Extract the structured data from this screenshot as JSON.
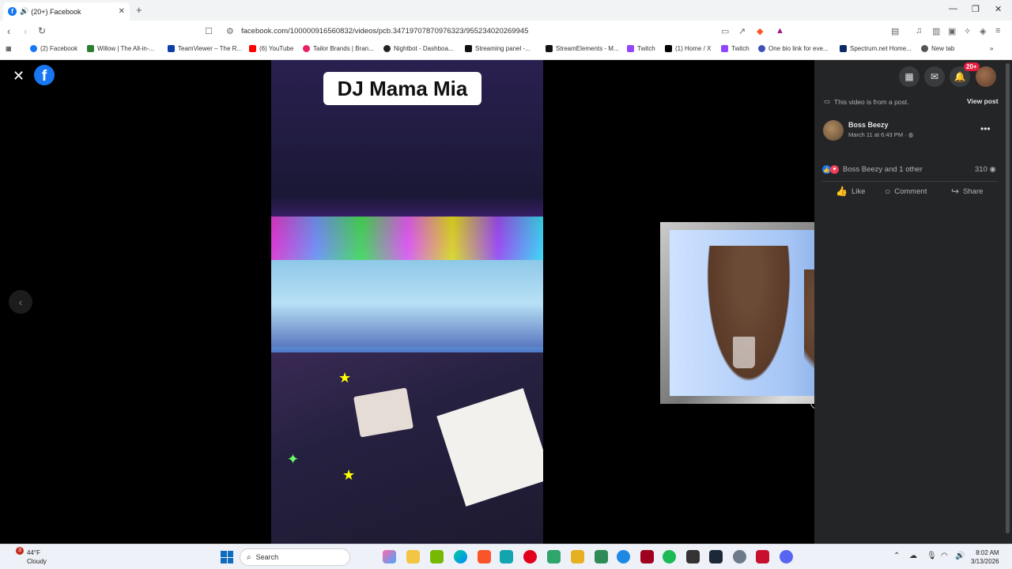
{
  "browser": {
    "tab_title": "(20+) Facebook",
    "new_tab_symbol": "+",
    "url": "facebook.com/100000916560832/videos/pcb.347197078709763​23/955234020269945",
    "bookmarks": [
      {
        "label": "(2) Facebook",
        "color": "#1877f2"
      },
      {
        "label": "Willow | The All-in-...",
        "color": "#2e7d32"
      },
      {
        "label": "TeamViewer – The R...",
        "color": "#0e3fa9"
      },
      {
        "label": "(6) YouTube",
        "color": "#ff0000"
      },
      {
        "label": "Tailor Brands | Bran...",
        "color": "#e91e63"
      },
      {
        "label": "Nightbot - Dashboa...",
        "color": "#222222"
      },
      {
        "label": "Streaming panel -...",
        "color": "#111111"
      },
      {
        "label": "StreamElements - M...",
        "color": "#111111"
      },
      {
        "label": "Twitch",
        "color": "#9146ff"
      },
      {
        "label": "(1) Home / X",
        "color": "#000000"
      },
      {
        "label": "Twitch",
        "color": "#9146ff"
      },
      {
        "label": "One bio link for eve...",
        "color": "#3f51b5"
      },
      {
        "label": "Spectrum.net Home...",
        "color": "#0a2a66"
      },
      {
        "label": "New tab",
        "color": "#555555"
      }
    ]
  },
  "viewer": {
    "video_title": "DJ Mama Mia"
  },
  "sidebar": {
    "notifications_badge": "20+",
    "post_note": "This video is from a post.",
    "view_post": "View post",
    "author": "Boss Beezy",
    "date": "March 11 at 6:43 PM · ",
    "reactions_text": "Boss Beezy and 1 other",
    "views": "310",
    "actions": {
      "like": "Like",
      "comment": "Comment",
      "share": "Share"
    }
  },
  "taskbar": {
    "temperature": "44°F",
    "condition": "Cloudy",
    "weather_badge": "3",
    "search_placeholder": "Search",
    "time": "8:02 AM",
    "date": "3/13/2026"
  }
}
